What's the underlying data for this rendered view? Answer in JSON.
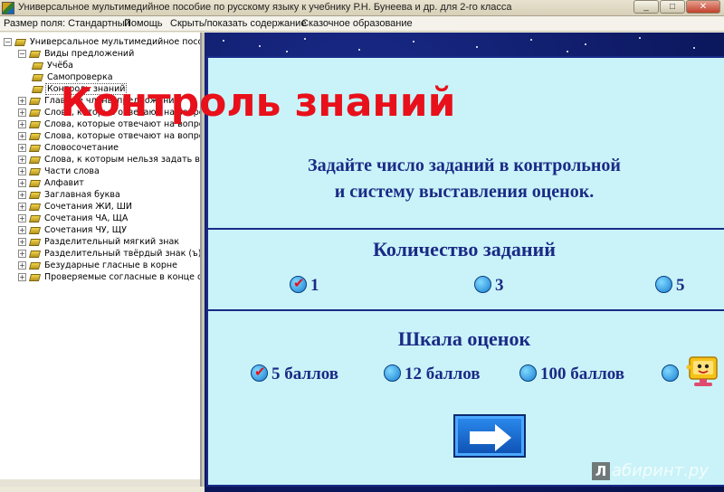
{
  "window": {
    "title": "Универсальное мультимедийное пособие по русскому языку к учебнику Р.Н. Бунеева и др. для 2-го класса",
    "min_label": "_",
    "max_label": "□",
    "close_label": "✕"
  },
  "menu": [
    "Размер поля: Стандартный",
    "Помощь",
    "Скрыть/показать содержание",
    "Сказочное образование"
  ],
  "tree": {
    "root": "Универсальное мультимедийное пособие по",
    "items": [
      {
        "label": "Виды предложений",
        "level": 1,
        "expanded": true
      },
      {
        "label": "Учёба",
        "level": 2
      },
      {
        "label": "Самопроверка",
        "level": 2
      },
      {
        "label": "Контроль знаний",
        "level": 2,
        "selected": true
      },
      {
        "label": "Главные члены предложения",
        "level": 1
      },
      {
        "label": "Слова, которые отвечают на вопросы КТ",
        "level": 1
      },
      {
        "label": "Слова, которые отвечают на вопросы КА",
        "level": 1
      },
      {
        "label": "Слова, которые отвечают на вопросы ЧТ",
        "level": 1
      },
      {
        "label": "Словосочетание",
        "level": 1
      },
      {
        "label": "Слова, к которым нельзя задать вопрос",
        "level": 1
      },
      {
        "label": "Части слова",
        "level": 1
      },
      {
        "label": "Алфавит",
        "level": 1
      },
      {
        "label": "Заглавная буква",
        "level": 1
      },
      {
        "label": "Сочетания ЖИ, ШИ",
        "level": 1
      },
      {
        "label": "Сочетания ЧА, ЩА",
        "level": 1
      },
      {
        "label": "Сочетания ЧУ, ЩУ",
        "level": 1
      },
      {
        "label": "Разделительный мягкий знак",
        "level": 1
      },
      {
        "label": "Разделительный твёрдый знак (ъ)",
        "level": 1
      },
      {
        "label": "Безударные гласные в корне",
        "level": 1
      },
      {
        "label": "Проверяемые согласные в конце слова",
        "level": 1
      }
    ]
  },
  "lesson": {
    "title": "Контроль знаний",
    "prompt_line1": "Задайте число заданий в контрольной",
    "prompt_line2": "и систему выставления оценок.",
    "tasks_heading": "Количество заданий",
    "task_options": [
      {
        "label": "1",
        "checked": true
      },
      {
        "label": "3",
        "checked": false
      },
      {
        "label": "5",
        "checked": false
      }
    ],
    "scale_heading": "Шкала оценок",
    "scale_options": [
      {
        "label": "5 баллов",
        "checked": true
      },
      {
        "label": "12 баллов",
        "checked": false
      },
      {
        "label": "100 баллов",
        "checked": false
      },
      {
        "label": "",
        "checked": false
      }
    ]
  },
  "watermark": {
    "logo": "Л",
    "text": "абиринт.ру"
  },
  "colors": {
    "title_red": "#e8101a",
    "text_navy": "#1b2a86",
    "card_bg": "#c9f3f8",
    "stage_bg": "#06104a"
  }
}
